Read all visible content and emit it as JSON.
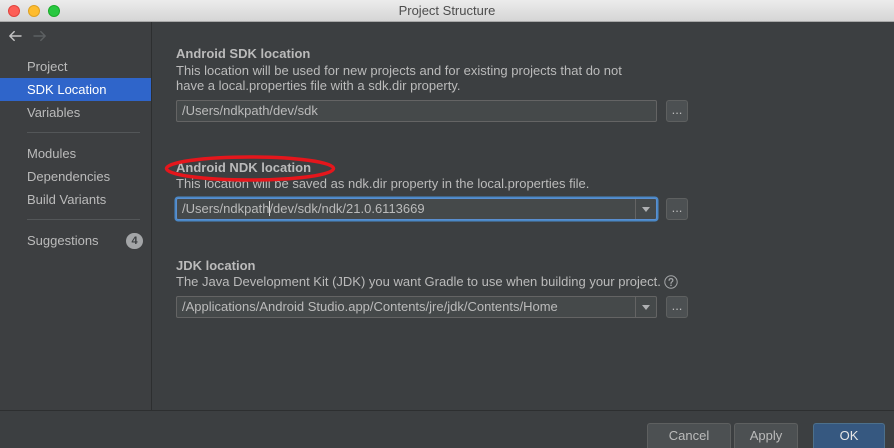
{
  "window": {
    "title": "Project Structure",
    "controls": [
      "close-button",
      "minimize-button",
      "zoom-button"
    ]
  },
  "nav": {
    "back_icon": "arrow-left-icon",
    "forward_icon": "arrow-right-icon",
    "forward_enabled": false
  },
  "sidebar": {
    "items": [
      {
        "label": "Project",
        "selected": false
      },
      {
        "label": "SDK Location",
        "selected": true
      },
      {
        "label": "Variables",
        "selected": false
      },
      {
        "label": "Modules",
        "selected": false
      },
      {
        "label": "Dependencies",
        "selected": false
      },
      {
        "label": "Build Variants",
        "selected": false
      },
      {
        "label": "Suggestions",
        "selected": false,
        "badge": "4"
      }
    ]
  },
  "sdk": {
    "title": "Android SDK location",
    "description_lines": [
      "This location will be used for new projects and for existing projects that do not",
      "have a local.properties file with a sdk.dir property."
    ],
    "value": "/Users/ndkpath/dev/sdk",
    "browse_label": "..."
  },
  "ndk": {
    "title": "Android NDK location",
    "description": "This location will be saved as ndk.dir property in the local.properties file.",
    "value": "/Users/ndkpath/dev/sdk/ndk/21.0.6113669",
    "caret_index": 14,
    "focused": true,
    "dropdown_icon": "dropdown-arrow-icon",
    "browse_label": "..."
  },
  "jdk": {
    "title": "JDK location",
    "description": "The Java Development Kit (JDK) you want Gradle to use when building your project.",
    "help_icon": "question-circle-icon",
    "value": "/Applications/Android Studio.app/Contents/jre/jdk/Contents/Home",
    "dropdown_icon": "dropdown-arrow-icon",
    "browse_label": "..."
  },
  "footer": {
    "cancel_label": "Cancel",
    "apply_label": "Apply",
    "ok_label": "OK"
  },
  "colors": {
    "selection": "#2f65ca",
    "primary_button": "#365880",
    "annotation": "#e5161c",
    "focus_ring": "#4a88c7"
  }
}
